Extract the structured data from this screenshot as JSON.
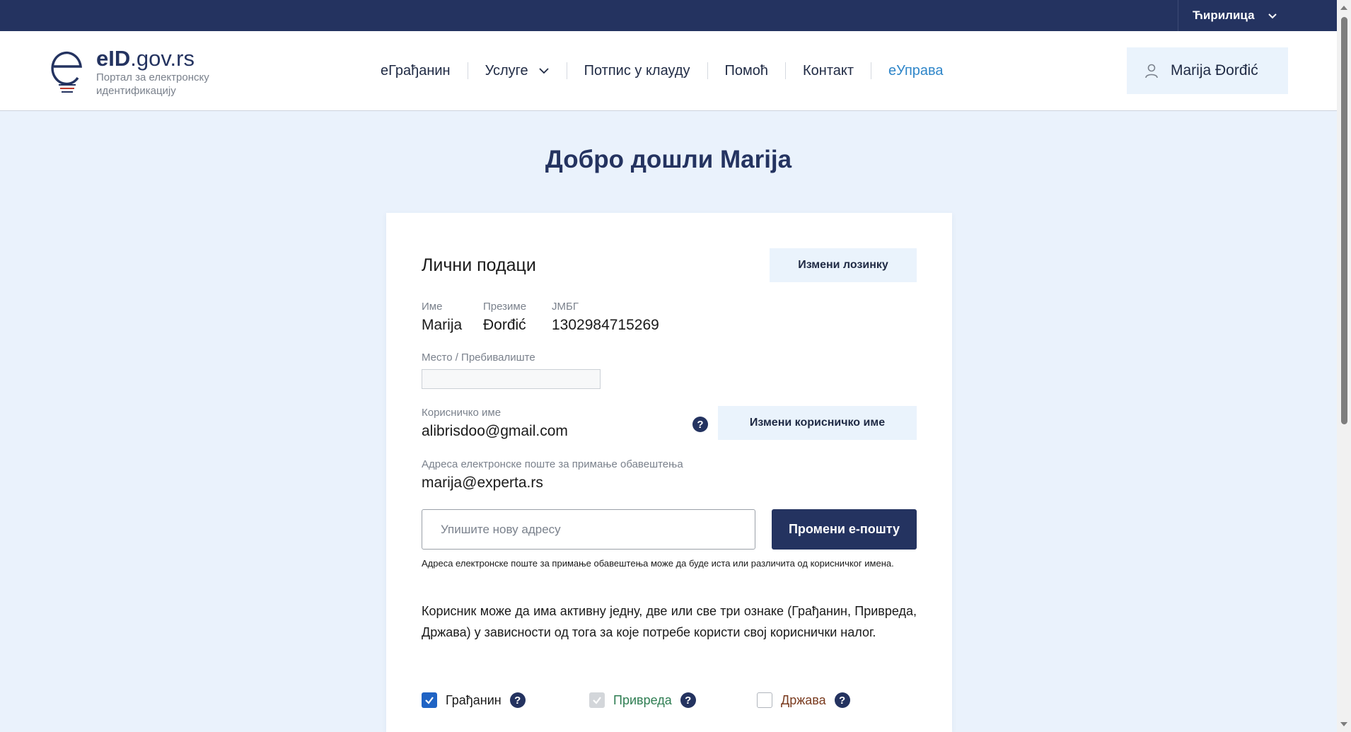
{
  "topbar": {
    "language_label": "Ћирилица"
  },
  "logo": {
    "brand_bold": "eID",
    "brand_rest": ".gov.rs",
    "subtitle": "Портал за електронску идентификацију"
  },
  "nav": {
    "items": [
      {
        "label": "еГрађанин"
      },
      {
        "label": "Услуге"
      },
      {
        "label": "Потпис у клауду"
      },
      {
        "label": "Помоћ"
      },
      {
        "label": "Контакт"
      },
      {
        "label": "еУправа"
      }
    ]
  },
  "user": {
    "name": "Marija Đorđić"
  },
  "welcome": "Добро дошли Marija",
  "card": {
    "title": "Лични подаци",
    "change_password_label": "Измени лозинку",
    "first_name_label": "Име",
    "first_name": "Marija",
    "last_name_label": "Презиме",
    "last_name": "Đorđić",
    "jmbg_label": "ЈМБГ",
    "jmbg": "1302984715269",
    "residence_label": "Место / Пребивалиште",
    "residence_value": "",
    "username_label": "Корисничко име",
    "username": "alibrisdoo@gmail.com",
    "change_username_label": "Измени корисничко име",
    "notify_email_label": "Адреса електронске поште за примање обавештења",
    "notify_email": "marija@experta.rs",
    "new_email_placeholder": "Упишите нову адресу",
    "change_email_label": "Промени е-пошту",
    "note": "Адреса електронске поште за примање обавештења може да буде иста или различита од корисничког имена.",
    "paragraph": "Корисник може да има активну једну, две или све три ознаке (Грађанин, Привреда, Држава) у зависности од тога за које потребе користи свој кориснички налог.",
    "roles": [
      {
        "label": "Грађанин",
        "state": "checked",
        "color": "#1a1a1a"
      },
      {
        "label": "Привреда",
        "state": "checked-disabled",
        "color": "#2e7d52"
      },
      {
        "label": "Држава",
        "state": "unchecked",
        "color": "#7a3b1f"
      }
    ],
    "help_glyph": "?"
  },
  "colors": {
    "navy": "#243360",
    "accent": "#2f86c9",
    "background": "#eaf2fc"
  }
}
